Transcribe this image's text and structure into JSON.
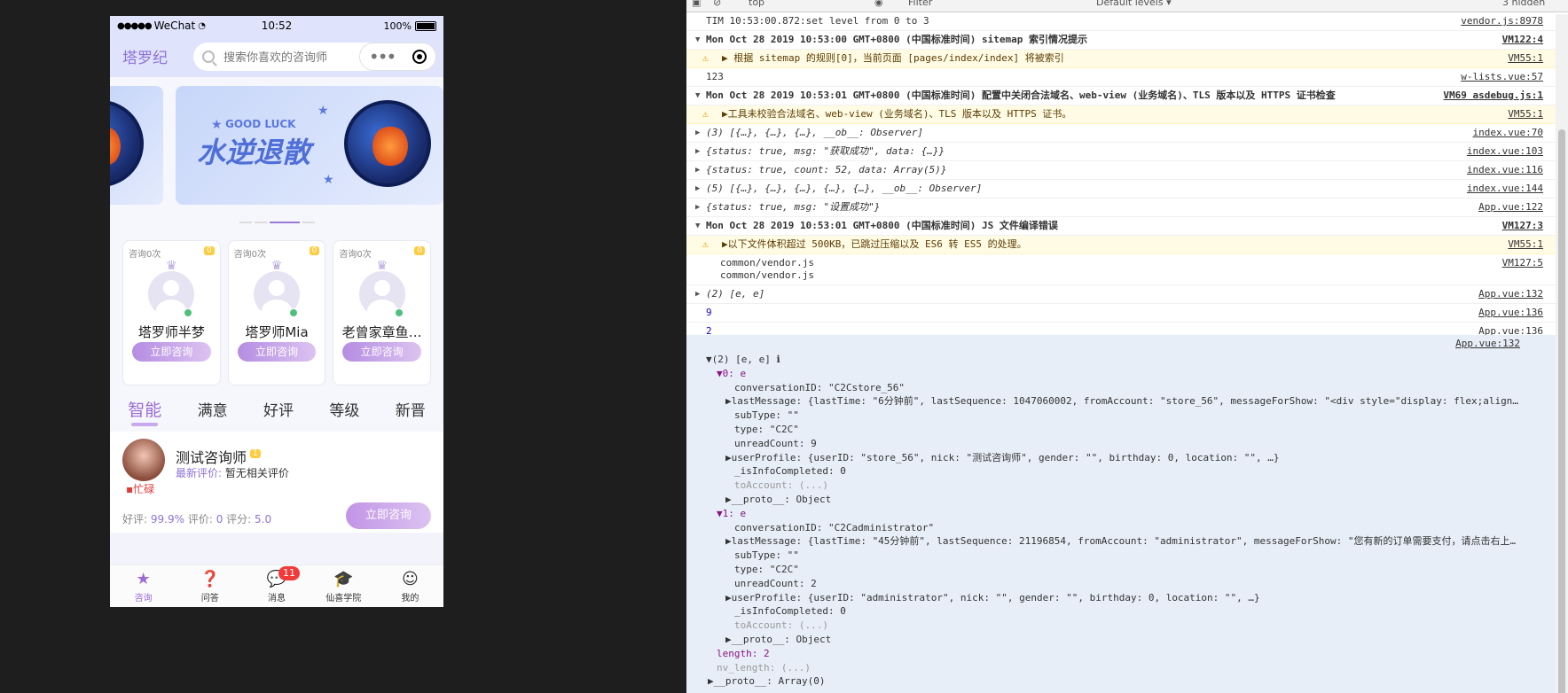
{
  "phone": {
    "status": {
      "signal": "●●●●●",
      "carrier": "WeChat",
      "time": "10:52",
      "battery": "100%"
    },
    "brand": "塔罗纪",
    "search_placeholder": "搜索你喜欢的咨询师",
    "banner": {
      "tag": "GOOD LUCK",
      "title": "水逆退散"
    },
    "cards": [
      {
        "count": "咨询0次",
        "badge": "0",
        "name": "塔罗师半梦",
        "button": "立即咨询"
      },
      {
        "count": "咨询0次",
        "badge": "0",
        "name": "塔罗师Mia",
        "button": "立即咨询"
      },
      {
        "count": "咨询0次",
        "badge": "0",
        "name": "老曾家章鱼…",
        "button": "立即咨询"
      }
    ],
    "tabs": [
      "智能",
      "满意",
      "好评",
      "等级",
      "新晋"
    ],
    "listitem": {
      "name": "测试咨询师",
      "badge": "1",
      "eval_label": "最新评价:",
      "eval_text": "暂无相关评价",
      "busy": "忙碌",
      "good_label": "好评:",
      "good_value": "99.9%",
      "review_label": "评价:",
      "review_value": "0",
      "score_label": "评分:",
      "score_value": "5.0",
      "button": "立即咨询"
    },
    "tabbar": [
      {
        "label": "咨询",
        "icon": "star-icon"
      },
      {
        "label": "问答",
        "icon": "question-icon"
      },
      {
        "label": "消息",
        "icon": "message-icon",
        "badge": "11"
      },
      {
        "label": "仙喜学院",
        "icon": "graduation-cap-icon"
      },
      {
        "label": "我的",
        "icon": "user-icon"
      }
    ]
  },
  "console": {
    "toolbar": {
      "context": "top",
      "filter_placeholder": "Filter",
      "levels": "Default levels ▾",
      "hidden": "3 hidden"
    },
    "rows": [
      {
        "text": "TIM 10:53:00.872:set level from 0 to 3",
        "src": "vendor.js:8978"
      },
      {
        "text": "Mon Oct 28 2019 10:53:00 GMT+0800 (中国标准时间) sitemap 索引情况提示",
        "src": "VM122:4"
      },
      {
        "text": "▶ 根据 sitemap 的规则[0]，当前页面 [pages/index/index] 将被索引",
        "src": "VM55:1"
      },
      {
        "text": "123",
        "src": "w-lists.vue:57"
      },
      {
        "text": "Mon Oct 28 2019 10:53:01 GMT+0800 (中国标准时间) 配置中关闭合法域名、web-view (业务域名)、TLS 版本以及 HTTPS 证书检查",
        "src": "VM69 asdebug.js:1"
      },
      {
        "text": "▶工具未校验合法域名、web-view (业务域名)、TLS 版本以及 HTTPS 证书。",
        "src": "VM55:1"
      },
      {
        "text": "(3) [{…}, {…}, {…}, __ob__: Observer]",
        "src": "index.vue:70"
      },
      {
        "text": "{status: true, msg: \"获取成功\", data: {…}}",
        "src": "index.vue:103"
      },
      {
        "text": "{status: true, count: 52, data: Array(5)}",
        "src": "index.vue:116"
      },
      {
        "text": "(5) [{…}, {…}, {…}, {…}, {…}, __ob__: Observer]",
        "src": "index.vue:144"
      },
      {
        "text": "{status: true, msg: \"设置成功\"}",
        "src": "App.vue:122"
      },
      {
        "text": "Mon Oct 28 2019 10:53:01 GMT+0800 (中国标准时间) JS 文件编译错误",
        "src": "VM127:3"
      },
      {
        "text": "▶以下文件体积超过 500KB，已跳过压缩以及 ES6 转 ES5 的处理。",
        "src": "VM55:1"
      },
      {
        "text": "common/vendor.js",
        "text2": "common/vendor.js",
        "src": "VM127:5"
      },
      {
        "text": "(2) [e, e]",
        "src": "App.vue:132"
      },
      {
        "text": "9",
        "src": "App.vue:136"
      },
      {
        "text": "2",
        "src": "App.vue:136"
      }
    ],
    "tree_src": "App.vue:132",
    "tree": [
      "▼(2) [e, e] ℹ",
      "▼0: e",
      "conversationID: \"C2Cstore_56\"",
      "▶lastMessage: {lastTime: \"6分钟前\", lastSequence: 1047060002, fromAccount: \"store_56\", messageForShow: \"<div style=\"display: flex;align-i…",
      "subType: \"\"",
      "type: \"C2C\"",
      "unreadCount: 9",
      "▶userProfile: {userID: \"store_56\", nick: \"测试咨询师\", gender: \"\", birthday: 0, location: \"\", …}",
      "_isInfoCompleted: 0",
      "toAccount: (...)",
      "▶__proto__: Object",
      "▼1: e",
      "conversationID: \"C2Cadministrator\"",
      "▶lastMessage: {lastTime: \"45分钟前\", lastSequence: 21196854, fromAccount: \"administrator\", messageForShow: \"您有新的订单需要支付，请点击右上…",
      "subType: \"\"",
      "type: \"C2C\"",
      "unreadCount: 2",
      "▶userProfile: {userID: \"administrator\", nick: \"\", gender: \"\", birthday: 0, location: \"\", …}",
      "_isInfoCompleted: 0",
      "toAccount: (...)",
      "▶__proto__: Object",
      "length: 2",
      "nv_length: (...)",
      "▶__proto__: Array(0)"
    ]
  }
}
